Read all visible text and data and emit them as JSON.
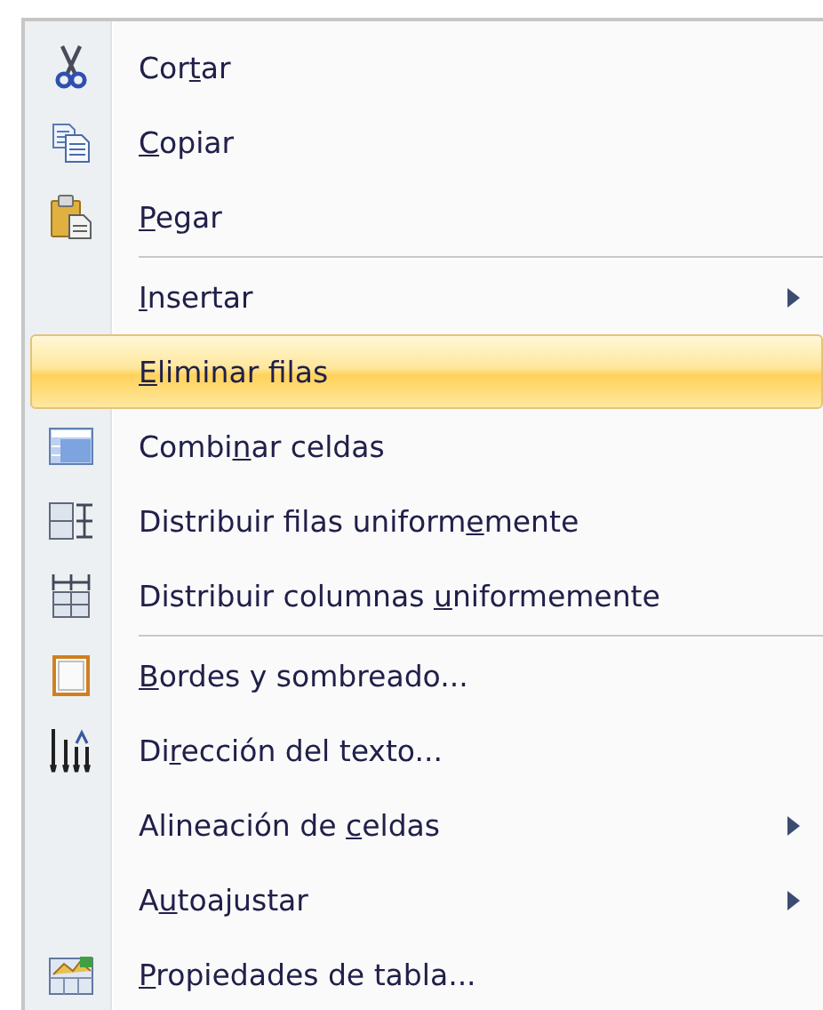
{
  "context_menu": {
    "groups": [
      [
        {
          "before": "Cor",
          "access_key": "t",
          "after": "ar",
          "submenu": false,
          "selected": false
        },
        {
          "access_key": "C",
          "after": "opiar",
          "submenu": false,
          "selected": false
        },
        {
          "access_key": "P",
          "after": "egar",
          "submenu": false,
          "selected": false
        }
      ],
      [
        {
          "access_key": "I",
          "after": "nsertar",
          "submenu": true,
          "selected": false
        },
        {
          "access_key": "E",
          "after": "liminar filas",
          "submenu": false,
          "selected": true
        },
        {
          "before": "Combi",
          "access_key": "n",
          "after": "ar celdas",
          "submenu": false,
          "selected": false
        },
        {
          "before": "Distribuir filas uniform",
          "access_key": "e",
          "after": "mente",
          "submenu": false,
          "selected": false
        },
        {
          "before": "Distribuir columnas ",
          "access_key": "u",
          "after": "niformemente",
          "submenu": false,
          "selected": false
        }
      ],
      [
        {
          "access_key": "B",
          "after": "ordes y sombreado...",
          "submenu": false,
          "selected": false
        },
        {
          "before": "Di",
          "access_key": "r",
          "after": "ección del texto...",
          "submenu": false,
          "selected": false
        },
        {
          "before": "Alineación de ",
          "access_key": "c",
          "after": "eldas",
          "submenu": true,
          "selected": false
        },
        {
          "before": "A",
          "access_key": "u",
          "after": "toajustar",
          "submenu": true,
          "selected": false
        },
        {
          "access_key": "P",
          "after": "ropiedades de tabla...",
          "submenu": false,
          "selected": false
        }
      ]
    ]
  }
}
